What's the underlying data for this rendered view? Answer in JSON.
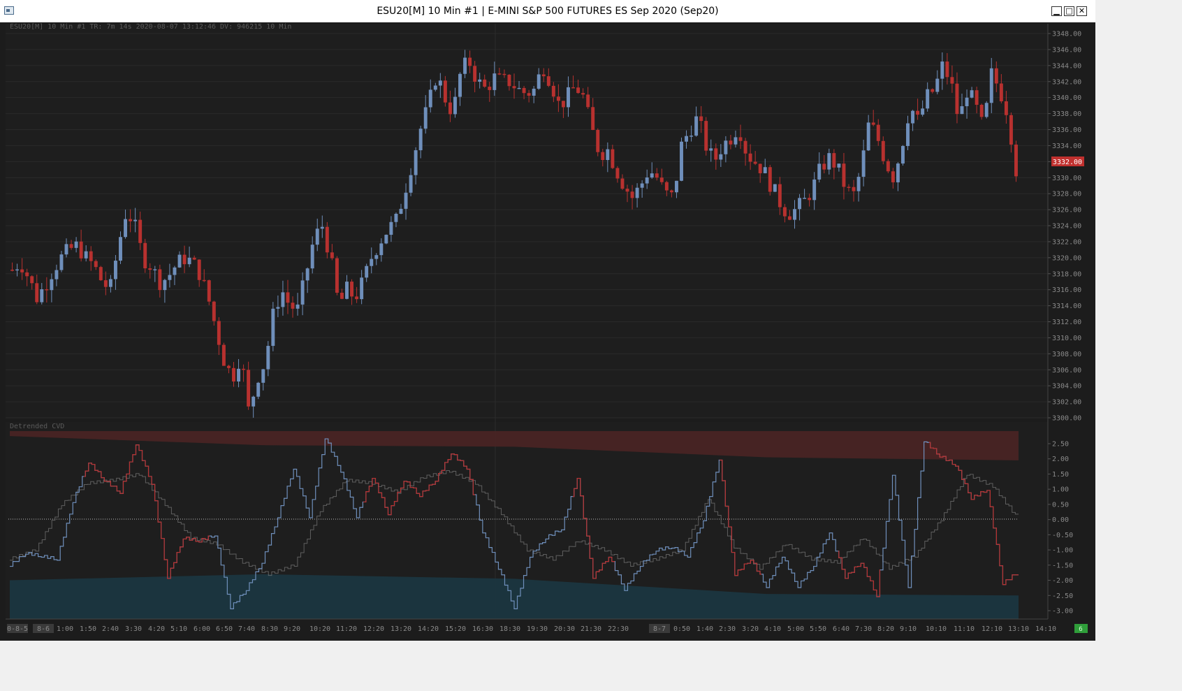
{
  "window": {
    "title": "ESU20[M]  10 Min   #1 | E-MINI S&P 500 FUTURES ES Sep 2020 (Sep20)",
    "buttons": {
      "minimize": "▁",
      "maximize": "□",
      "close": "✕"
    }
  },
  "header_info": "ESU20[M]  10 Min   #1 TR: 7m 14s 2020-08-07 13:12:46 DV: 946215 10 Min",
  "indicator_label": "Detrended CVD",
  "current_price": "3332.00",
  "colors": {
    "background": "#1c1c1c",
    "up": "#6f8fbb",
    "down": "#b8312f",
    "price_badge": "#c0302e",
    "upper_band": "#4a2424",
    "lower_band": "#1b3640",
    "axis_text": "#8a8a8a",
    "grid": "#2a2a2a"
  },
  "bottom_badge": "6",
  "chart_data": [
    {
      "type": "candlestick",
      "title": "",
      "ylim": [
        3299,
        3349
      ],
      "y_ticks": [
        "3348.00",
        "3346.00",
        "3344.00",
        "3342.00",
        "3340.00",
        "3338.00",
        "3336.00",
        "3334.00",
        "3332.00",
        "3330.00",
        "3328.00",
        "3326.00",
        "3324.00",
        "3322.00",
        "3320.00",
        "3318.00",
        "3316.00",
        "3314.00",
        "3312.00",
        "3310.00",
        "3308.00",
        "3306.00",
        "3304.00",
        "3302.00",
        "3300.00"
      ],
      "close_path": [
        3318.5,
        3319.5,
        3317.5,
        3315,
        3316.5,
        3318.5,
        3320,
        3321,
        3321.5,
        3320,
        3319,
        3317,
        3316,
        3321.5,
        3326,
        3324,
        3320,
        3319,
        3317,
        3317.5,
        3319,
        3320,
        3319.5,
        3318,
        3315,
        3311,
        3307,
        3305,
        3308,
        3300.5,
        3305,
        3307,
        3313,
        3316,
        3314,
        3313.5,
        3318,
        3322.5,
        3324,
        3320,
        3314,
        3316,
        3315,
        3317,
        3320,
        3322,
        3323.5,
        3324.5,
        3328,
        3332,
        3336,
        3339,
        3343,
        3340,
        3338,
        3343.5,
        3344.5,
        3342,
        3341,
        3342.5,
        3342,
        3342,
        3341,
        3340.5,
        3341,
        3344,
        3342,
        3339,
        3340,
        3341.5,
        3340,
        3336,
        3333,
        3333.5,
        3331,
        3329,
        3327.5,
        3329,
        3331,
        3330,
        3328,
        3327.5,
        3334,
        3336,
        3337.5,
        3334,
        3332,
        3334,
        3335,
        3336.5,
        3333,
        3332,
        3331,
        3329,
        3327,
        3325.5,
        3326,
        3327,
        3328.5,
        3331,
        3332.5,
        3331.5,
        3329,
        3327.5,
        3331,
        3337,
        3335,
        3332,
        3330,
        3334,
        3339,
        3337,
        3340,
        3341,
        3344,
        3342,
        3337,
        3341,
        3339,
        3336,
        3343,
        3341,
        3338,
        3331
      ]
    },
    {
      "type": "line",
      "title": "Detrended CVD",
      "ylim": [
        -3.25,
        2.9
      ],
      "y_ticks": [
        "2.50",
        "2.00",
        "1.50",
        "1.00",
        "0.50",
        "0.00",
        "-0.50",
        "-1.00",
        "-1.50",
        "-2.00",
        "-2.50",
        "-3.00"
      ],
      "x_ticks": [
        "0-8-5",
        "8-6",
        "1:00",
        "1:50",
        "2:40",
        "3:30",
        "4:20",
        "5:10",
        "6:00",
        "6:50",
        "7:40",
        "8:30",
        "9:20",
        "10:20",
        "11:20",
        "12:20",
        "13:20",
        "14:20",
        "15:20",
        "16:30",
        "18:30",
        "19:30",
        "20:30",
        "21:30",
        "22:30",
        "8-7",
        "0:50",
        "1:40",
        "2:30",
        "3:20",
        "4:10",
        "5:00",
        "5:50",
        "6:40",
        "7:30",
        "8:20",
        "9:10",
        "10:10",
        "11:10",
        "12:10",
        "13:10",
        "14:10"
      ],
      "upper_band": [
        2.75,
        2.45,
        2.4,
        2.05,
        1.95
      ],
      "lower_band": [
        -2.0,
        -1.8,
        -1.95,
        -2.45,
        -2.5
      ],
      "series": [
        {
          "values": [
            -1.5,
            -1.1,
            -1.2,
            -1.3,
            0.6,
            1.9,
            1.3,
            0.9,
            2.5,
            1.2,
            -1.9,
            -0.6,
            -0.7,
            -0.5,
            -2.9,
            -2.3,
            -1.4,
            0.1,
            1.7,
            0.1,
            2.7,
            1.6,
            0.1,
            1.4,
            0.2,
            1.3,
            0.8,
            1.3,
            2.2,
            1.7,
            -0.4,
            -1.6,
            -2.9,
            -1.2,
            -0.6,
            -0.3,
            1.4,
            -1.9,
            -1.2,
            -2.3,
            -1.5,
            -1.0,
            -0.9,
            -1.2,
            0.0,
            2.0,
            -1.8,
            -1.3,
            -2.2,
            -1.2,
            -2.2,
            -1.5,
            -0.4,
            -1.9,
            -1.4,
            -2.5,
            1.5,
            -2.2,
            2.6,
            2.1,
            1.8,
            0.7,
            1.0,
            -2.1,
            -1.7
          ]
        },
        {
          "values": [
            -1.3,
            -1.0,
            0.5,
            1.2,
            1.3,
            1.5,
            0.5,
            -0.6,
            -0.8,
            -1.4,
            -1.8,
            -1.5,
            0.3,
            1.3,
            1.2,
            0.9,
            1.4,
            1.6,
            1.2,
            0.2,
            -1.0,
            -1.3,
            -0.7,
            -1.0,
            -1.5,
            -1.3,
            -1.0,
            0.7,
            -0.9,
            -1.6,
            -0.8,
            -1.3,
            -1.4,
            -0.6,
            -1.6,
            -1.2,
            0.0,
            1.5,
            1.1,
            0.0
          ]
        }
      ]
    }
  ]
}
